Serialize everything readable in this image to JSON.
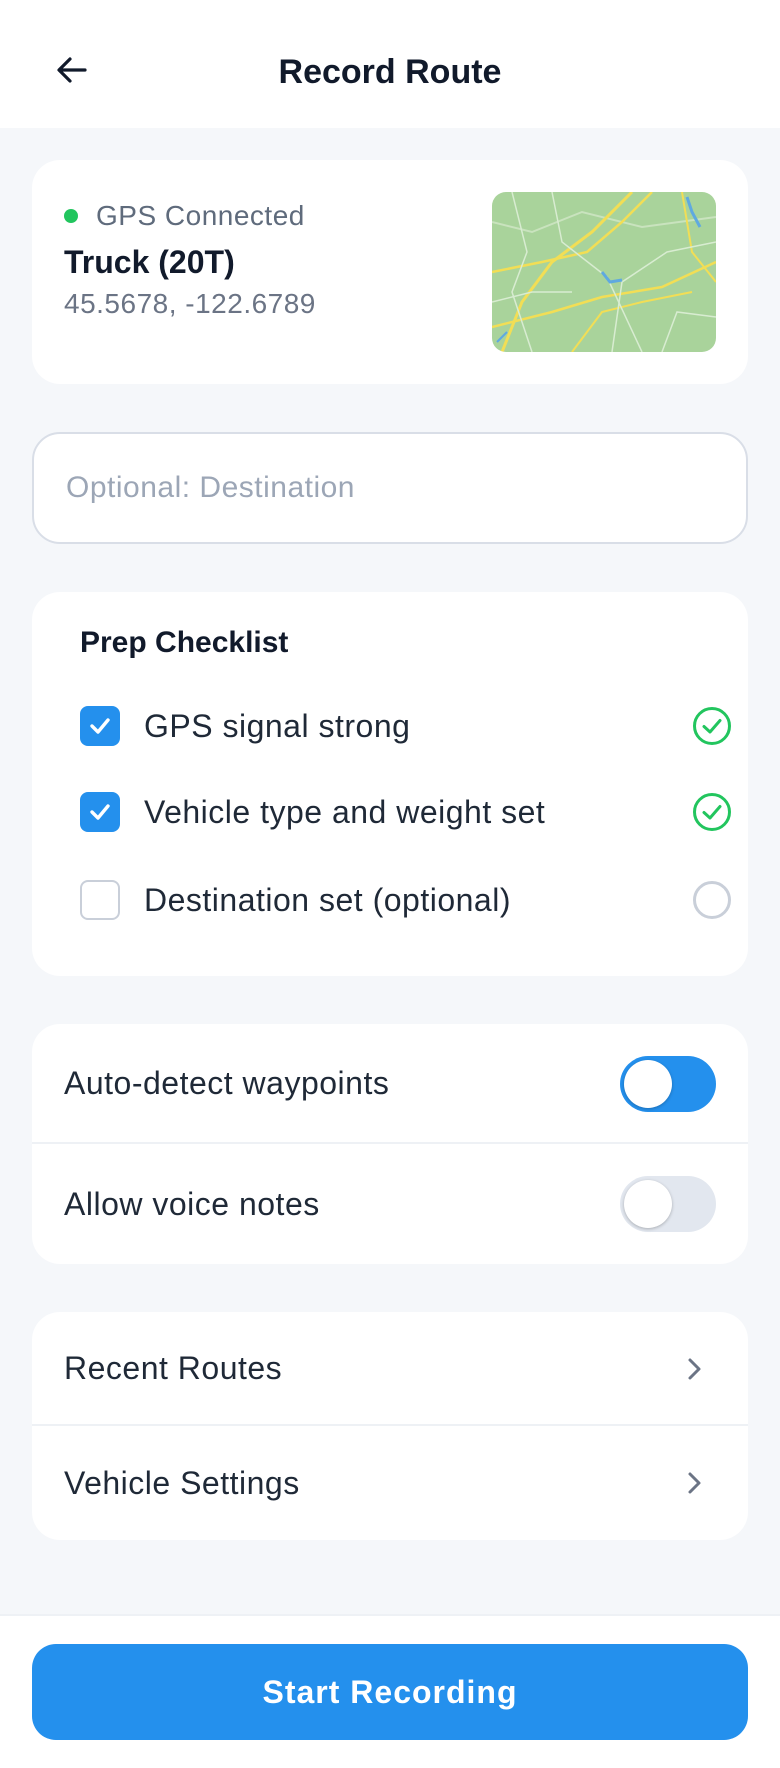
{
  "header": {
    "title": "Record Route",
    "back_icon": "arrow-left-icon"
  },
  "gps": {
    "status_text": "GPS Connected",
    "status_color": "#22c55e",
    "vehicle": "Truck (20T)",
    "coordinates": "45.5678, -122.6789",
    "map_icon": "map-thumbnail"
  },
  "destination": {
    "value": "",
    "placeholder": "Optional: Destination"
  },
  "checklist": {
    "title": "Prep Checklist",
    "items": [
      {
        "label": "GPS signal strong",
        "checked": true,
        "status": "check-circle-icon"
      },
      {
        "label": "Vehicle type and weight set",
        "checked": true,
        "status": "check-circle-icon"
      },
      {
        "label": "Destination set (optional)",
        "checked": false,
        "status": "empty-circle-icon"
      }
    ]
  },
  "toggles": [
    {
      "label": "Auto-detect waypoints",
      "on": true
    },
    {
      "label": "Allow voice notes",
      "on": false
    }
  ],
  "nav": [
    {
      "label": "Recent Routes",
      "icon": "chevron-right-icon"
    },
    {
      "label": "Vehicle Settings",
      "icon": "chevron-right-icon"
    }
  ],
  "footer": {
    "start_label": "Start Recording"
  },
  "colors": {
    "accent": "#2490ed",
    "success": "#22c55e",
    "background": "#f5f7fa"
  }
}
